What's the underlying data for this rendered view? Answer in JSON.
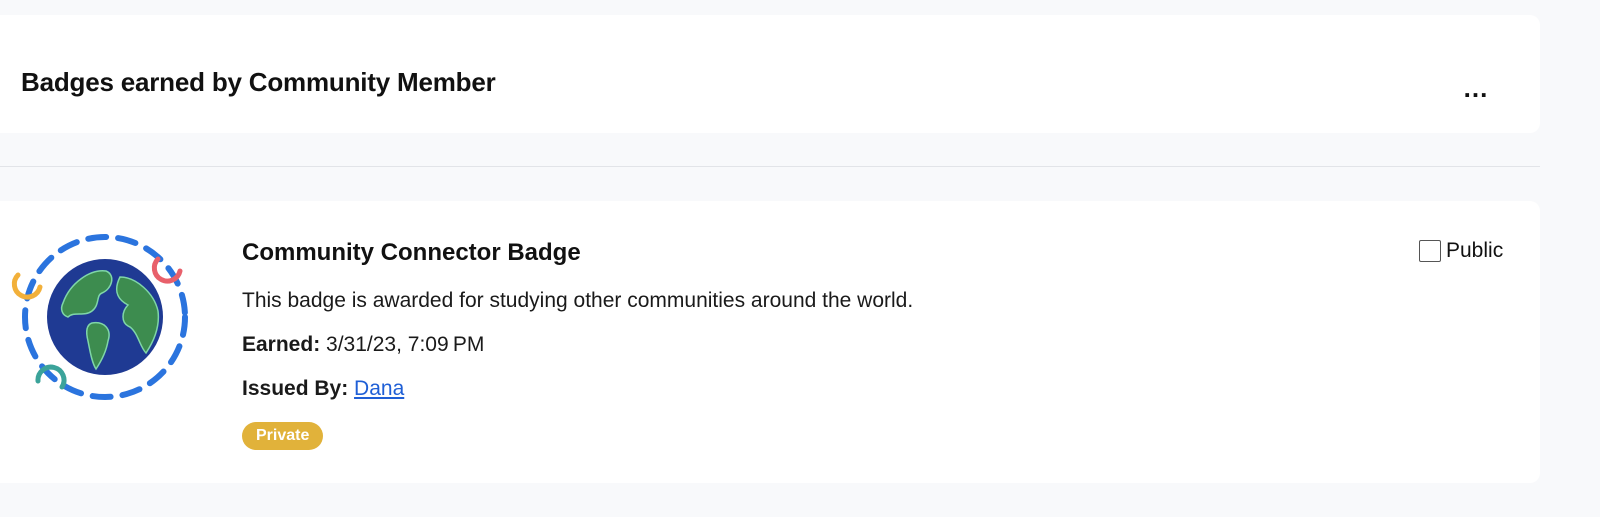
{
  "header": {
    "title": "Badges earned by Community Member",
    "more_label": "..."
  },
  "badge": {
    "icon": "globe-badge-icon",
    "title": "Community Connector Badge",
    "description": "This badge is awarded for studying other communities around the world.",
    "earned_label": "Earned:",
    "earned_value": "3/31/23, 7:09 PM",
    "issued_label": "Issued By:",
    "issued_value": "Dana",
    "status": "Private",
    "public_label": "Public",
    "public_checked": false
  },
  "colors": {
    "ring": "#2b74de",
    "ocean": "#1f3a93",
    "land": "#3d8c4f",
    "accent_orange": "#f2b03a",
    "accent_red": "#e8606b",
    "accent_teal": "#3ba39a",
    "status_pill": "#e1b23a",
    "link": "#1f5fd6"
  }
}
